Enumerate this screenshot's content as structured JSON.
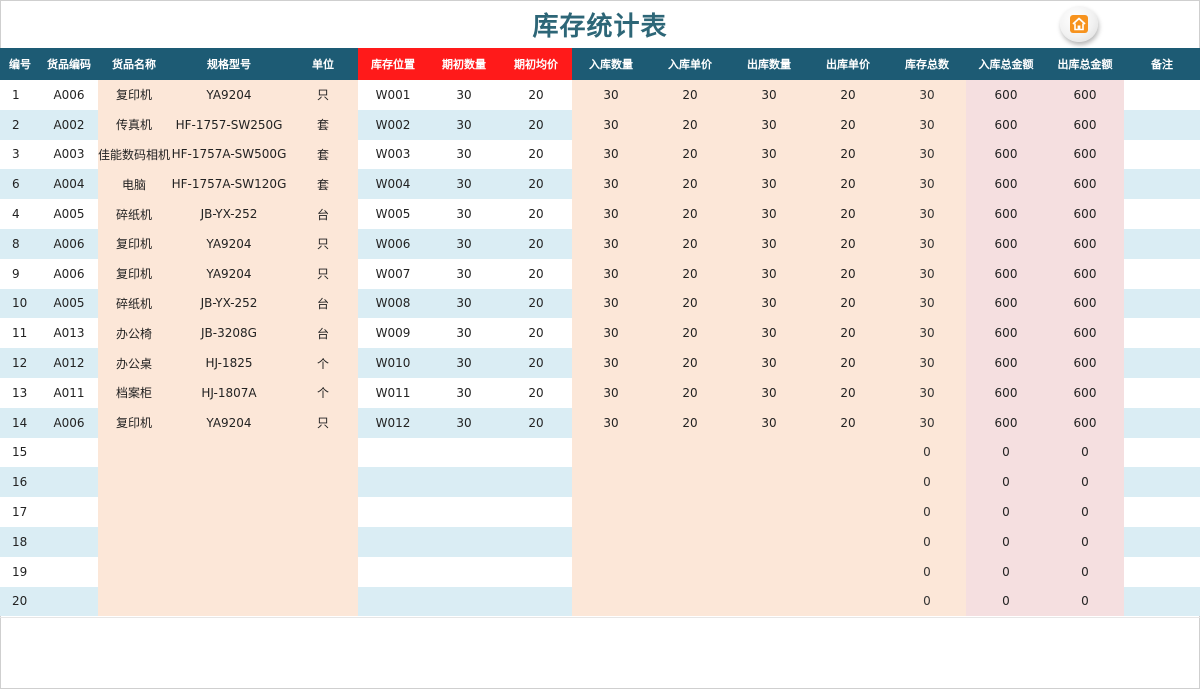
{
  "title": "库存统计表",
  "icons": {
    "home": "home-icon"
  },
  "colors": {
    "header_bg": "#1d5b74",
    "header_red": "#ff1a1a",
    "title": "#2d6677",
    "stripe": "#daedf4",
    "peach": "#fce7d8",
    "pink": "#f5dfe0",
    "home_icon": "#f7931e"
  },
  "columns": [
    "编号",
    "货品编码",
    "货品名称",
    "规格型号",
    "单位",
    "库存位置",
    "期初数量",
    "期初均价",
    "入库数量",
    "入库单价",
    "出库数量",
    "出库单价",
    "库存总数",
    "入库总金额",
    "出库总金额",
    "备注"
  ],
  "rows": [
    [
      "1",
      "A006",
      "复印机",
      "YA9204",
      "只",
      "W001",
      "30",
      "20",
      "30",
      "20",
      "30",
      "20",
      "30",
      "600",
      "600",
      ""
    ],
    [
      "2",
      "A002",
      "传真机",
      "HF-1757-SW250G",
      "套",
      "W002",
      "30",
      "20",
      "30",
      "20",
      "30",
      "20",
      "30",
      "600",
      "600",
      ""
    ],
    [
      "3",
      "A003",
      "佳能数码相机",
      "HF-1757A-SW500G",
      "套",
      "W003",
      "30",
      "20",
      "30",
      "20",
      "30",
      "20",
      "30",
      "600",
      "600",
      ""
    ],
    [
      "6",
      "A004",
      "电脑",
      "HF-1757A-SW120G",
      "套",
      "W004",
      "30",
      "20",
      "30",
      "20",
      "30",
      "20",
      "30",
      "600",
      "600",
      ""
    ],
    [
      "4",
      "A005",
      "碎纸机",
      "JB-YX-252",
      "台",
      "W005",
      "30",
      "20",
      "30",
      "20",
      "30",
      "20",
      "30",
      "600",
      "600",
      ""
    ],
    [
      "8",
      "A006",
      "复印机",
      "YA9204",
      "只",
      "W006",
      "30",
      "20",
      "30",
      "20",
      "30",
      "20",
      "30",
      "600",
      "600",
      ""
    ],
    [
      "9",
      "A006",
      "复印机",
      "YA9204",
      "只",
      "W007",
      "30",
      "20",
      "30",
      "20",
      "30",
      "20",
      "30",
      "600",
      "600",
      ""
    ],
    [
      "10",
      "A005",
      "碎纸机",
      "JB-YX-252",
      "台",
      "W008",
      "30",
      "20",
      "30",
      "20",
      "30",
      "20",
      "30",
      "600",
      "600",
      ""
    ],
    [
      "11",
      "A013",
      "办公椅",
      "JB-3208G",
      "台",
      "W009",
      "30",
      "20",
      "30",
      "20",
      "30",
      "20",
      "30",
      "600",
      "600",
      ""
    ],
    [
      "12",
      "A012",
      "办公桌",
      "HJ-1825",
      "个",
      "W010",
      "30",
      "20",
      "30",
      "20",
      "30",
      "20",
      "30",
      "600",
      "600",
      ""
    ],
    [
      "13",
      "A011",
      "档案柜",
      "HJ-1807A",
      "个",
      "W011",
      "30",
      "20",
      "30",
      "20",
      "30",
      "20",
      "30",
      "600",
      "600",
      ""
    ],
    [
      "14",
      "A006",
      "复印机",
      "YA9204",
      "只",
      "W012",
      "30",
      "20",
      "30",
      "20",
      "30",
      "20",
      "30",
      "600",
      "600",
      ""
    ],
    [
      "15",
      "",
      "",
      "",
      "",
      "",
      "",
      "",
      "",
      "",
      "",
      "",
      "0",
      "0",
      "0",
      ""
    ],
    [
      "16",
      "",
      "",
      "",
      "",
      "",
      "",
      "",
      "",
      "",
      "",
      "",
      "0",
      "0",
      "0",
      ""
    ],
    [
      "17",
      "",
      "",
      "",
      "",
      "",
      "",
      "",
      "",
      "",
      "",
      "",
      "0",
      "0",
      "0",
      ""
    ],
    [
      "18",
      "",
      "",
      "",
      "",
      "",
      "",
      "",
      "",
      "",
      "",
      "",
      "0",
      "0",
      "0",
      ""
    ],
    [
      "19",
      "",
      "",
      "",
      "",
      "",
      "",
      "",
      "",
      "",
      "",
      "",
      "0",
      "0",
      "0",
      ""
    ],
    [
      "20",
      "",
      "",
      "",
      "",
      "",
      "",
      "",
      "",
      "",
      "",
      "",
      "0",
      "0",
      "0",
      ""
    ]
  ]
}
